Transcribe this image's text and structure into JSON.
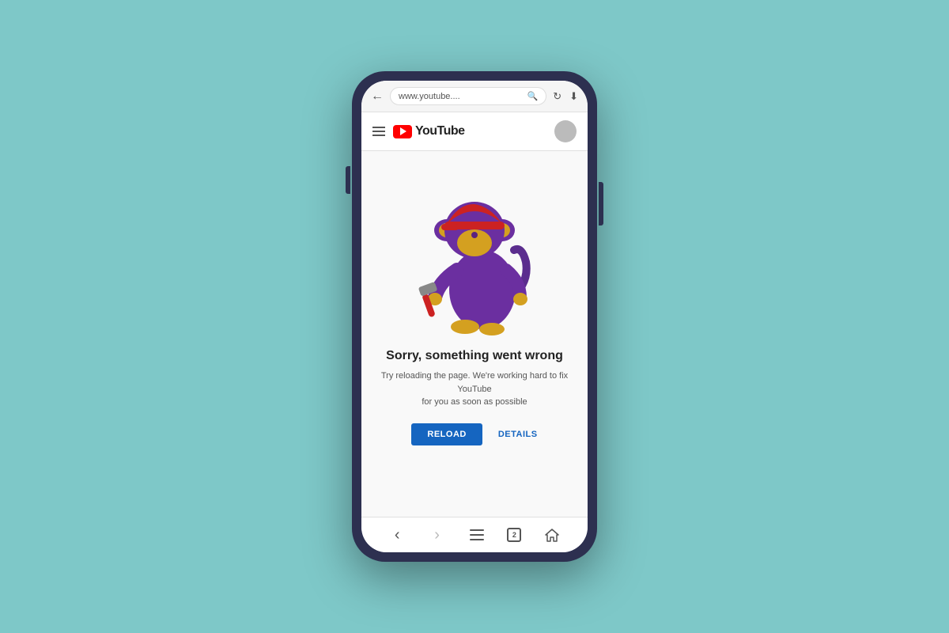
{
  "background_color": "#7ec8c8",
  "phone": {
    "browser": {
      "url": "www.youtube....",
      "back_arrow": "←"
    },
    "header": {
      "logo_text": "YouTube",
      "menu_label": "menu"
    },
    "error": {
      "title": "Sorry, something went wrong",
      "subtitle": "Try reloading the page. We're working hard to fix YouTube\nfor you as soon as possible",
      "reload_button": "RELOAD",
      "details_button": "DETAILS"
    },
    "navbar": {
      "back": "‹",
      "forward": "›"
    }
  }
}
